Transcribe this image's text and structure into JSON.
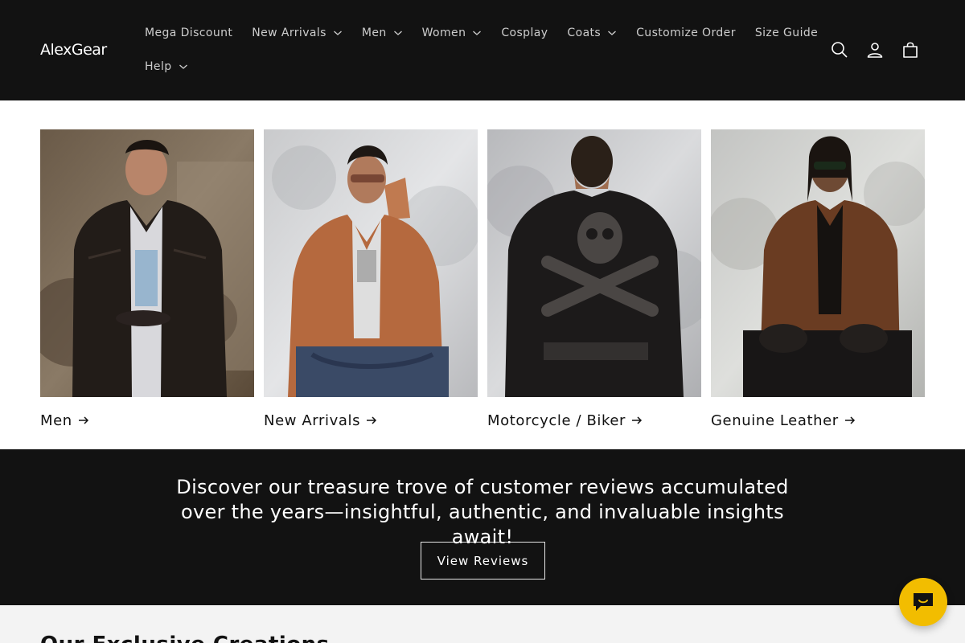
{
  "header": {
    "logo_text": "AlexGear",
    "nav": [
      {
        "label": "Mega Discount",
        "has_dropdown": false
      },
      {
        "label": "New Arrivals",
        "has_dropdown": true
      },
      {
        "label": "Men",
        "has_dropdown": true
      },
      {
        "label": "Women",
        "has_dropdown": true
      },
      {
        "label": "Cosplay",
        "has_dropdown": false
      },
      {
        "label": "Coats",
        "has_dropdown": true
      },
      {
        "label": "Customize Order",
        "has_dropdown": false
      },
      {
        "label": "Size Guide",
        "has_dropdown": false
      },
      {
        "label": "Help",
        "has_dropdown": true
      }
    ],
    "icons": [
      "search-icon",
      "account-icon",
      "cart-icon"
    ]
  },
  "collections": [
    {
      "title": "Men",
      "image": "man-black-leather-jacket-photo"
    },
    {
      "title": "New Arrivals",
      "image": "man-tan-leather-jacket-photo"
    },
    {
      "title": "Motorcycle / Biker",
      "image": "man-black-skull-biker-jacket-back-photo"
    },
    {
      "title": "Genuine Leather",
      "image": "man-brown-leather-jacket-photo"
    }
  ],
  "banner": {
    "text": "Discover our treasure trove of customer reviews accumulated over the years—insightful, authentic, and invaluable insights await!",
    "button_label": "View Reviews"
  },
  "bottom": {
    "heading": "Our Exclusive Creations"
  },
  "chat": {
    "icon": "chat-icon"
  },
  "colors": {
    "header_bg": "#121212",
    "banner_bg": "#121212",
    "bottom_bg": "#f3f3f3",
    "chat_bg": "#f2bd00",
    "text_dark": "#121212"
  }
}
